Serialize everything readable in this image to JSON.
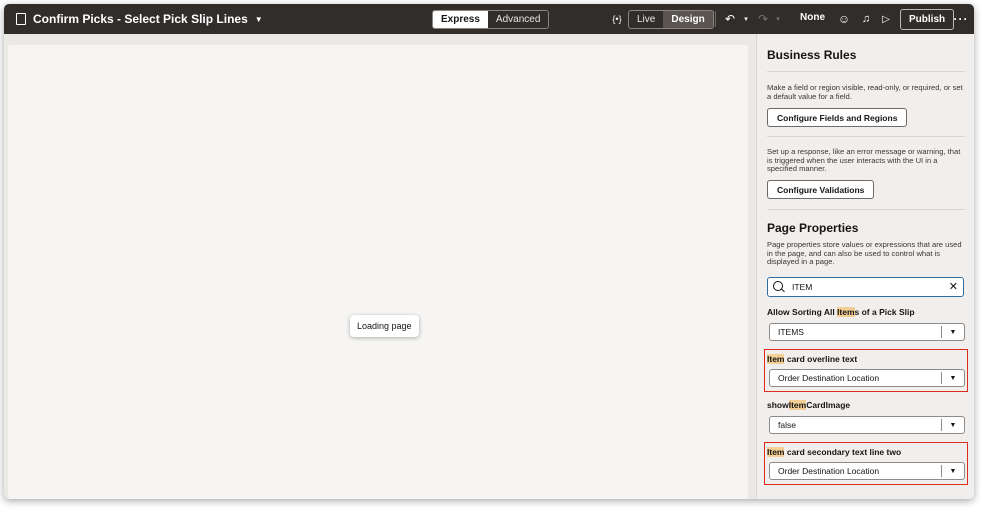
{
  "header": {
    "title": "Confirm Picks - Select Pick Slip Lines",
    "mode_tabs": [
      "Express",
      "Advanced"
    ],
    "view_tabs": [
      "Live",
      "Design"
    ],
    "bracket_icon_text": "{•}",
    "none_label": "None",
    "publish_label": "Publish"
  },
  "canvas": {
    "loading_text": "Loading page"
  },
  "panel": {
    "business_rules": {
      "heading": "Business Rules",
      "fields_description": "Make a field or region visible, read-only, or required, or set a default value for a field.",
      "fields_button": "Configure Fields and Regions",
      "validations_description": "Set up a response, like an error message or warning, that is triggered when the user interacts with the UI in a specified manner.",
      "validations_button": "Configure Validations"
    },
    "page_properties": {
      "heading": "Page Properties",
      "description": "Page properties store values or expressions that are used in the page, and can also be used to control what is displayed in a page.",
      "search_value": "ITEM",
      "properties": [
        {
          "label_pre": "Allow Sorting All ",
          "label_hl": "Item",
          "label_post": "s of a Pick Slip",
          "value": "ITEMS"
        },
        {
          "label_pre": "",
          "label_hl": "Item",
          "label_post": " card overline text",
          "value": "Order Destination Location"
        },
        {
          "label_pre": "show",
          "label_hl": "Item",
          "label_post": "CardImage",
          "value": "false"
        },
        {
          "label_pre": "",
          "label_hl": "Item",
          "label_post": " card secondary text line two",
          "value": "Order Destination Location"
        }
      ]
    }
  },
  "colors": {
    "topbar": "#312d2a",
    "highlight": "#f4cf95",
    "callout": "#e0291b",
    "focus": "#2e6ca4"
  }
}
